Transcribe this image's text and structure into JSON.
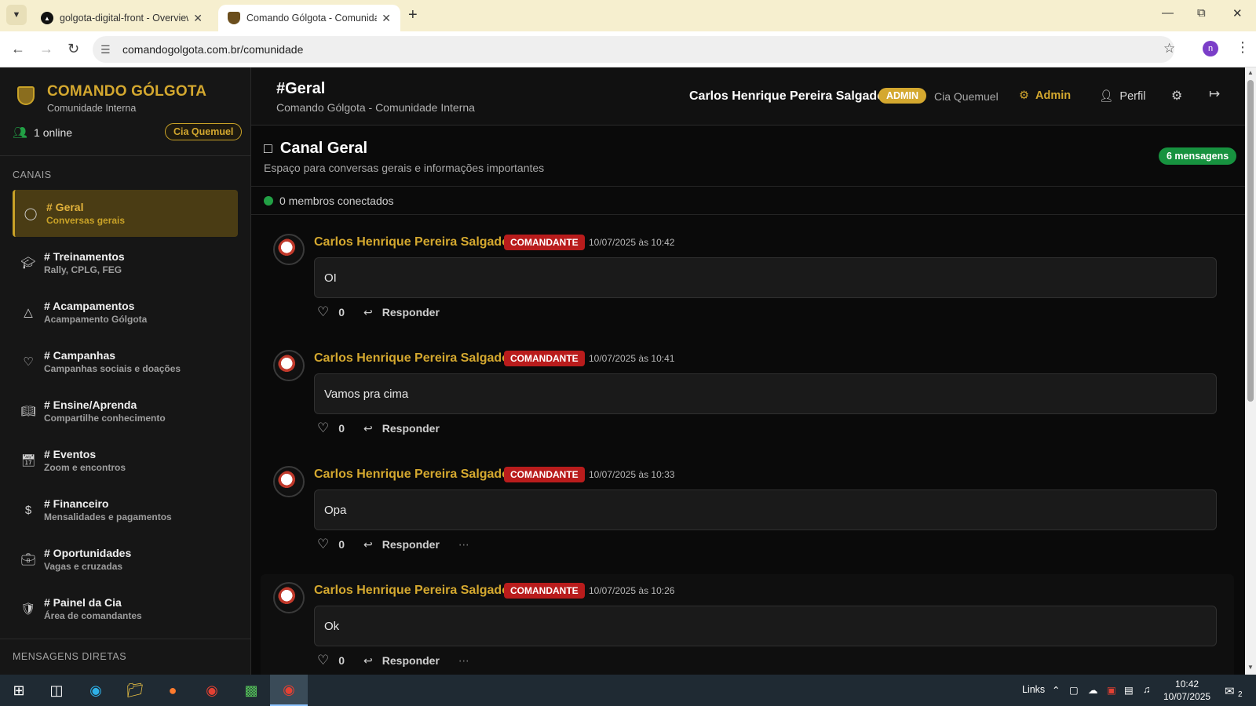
{
  "browser": {
    "tabs": [
      {
        "title": "golgota-digital-front - Overview",
        "active": false
      },
      {
        "title": "Comando Gólgota - Comunidade",
        "active": true
      }
    ],
    "url": "comandogolgota.com.br/comunidade",
    "profile_initial": "n"
  },
  "sidebar": {
    "brand_name": "COMANDO GÓLGOTA",
    "brand_sub": "Comunidade Interna",
    "online_text": "1 online",
    "cia_pill": "Cia Quemuel",
    "channels_label": "CANAIS",
    "channels": [
      {
        "name": "# Geral",
        "desc": "Conversas gerais",
        "icon": "chat-bubble-icon",
        "active": true
      },
      {
        "name": "# Treinamentos",
        "desc": "Rally, CPLG, FEG",
        "icon": "graduation-cap-icon",
        "active": false
      },
      {
        "name": "# Acampamentos",
        "desc": "Acampamento Gólgota",
        "icon": "tent-icon",
        "active": false
      },
      {
        "name": "# Campanhas",
        "desc": "Campanhas sociais e doações",
        "icon": "heart-icon",
        "active": false
      },
      {
        "name": "# Ensine/Aprenda",
        "desc": "Compartilhe conhecimento",
        "icon": "book-icon",
        "active": false
      },
      {
        "name": "# Eventos",
        "desc": "Zoom e encontros",
        "icon": "calendar-icon",
        "active": false
      },
      {
        "name": "# Financeiro",
        "desc": "Mensalidades e pagamentos",
        "icon": "dollar-icon",
        "active": false
      },
      {
        "name": "# Oportunidades",
        "desc": "Vagas e cruzadas",
        "icon": "briefcase-icon",
        "active": false
      },
      {
        "name": "# Painel da Cia",
        "desc": "Área de comandantes",
        "icon": "shield-icon",
        "active": false
      }
    ],
    "dm_label": "MENSAGENS DIRETAS"
  },
  "topbar": {
    "title": "#Geral",
    "subtitle": "Comando Gólgota - Comunidade Interna",
    "user_name": "Carlos Henrique Pereira Salgado",
    "role_badge": "ADMIN",
    "cia": "Cia Quemuel",
    "admin_link": "Admin",
    "profile_link": "Perfil"
  },
  "channel_header": {
    "title": "Canal Geral",
    "subtitle": "Espaço para conversas gerais e informações importantes",
    "message_count": "6 mensagens",
    "members_text": "0 membros conectados"
  },
  "messages": [
    {
      "author": "Carlos Henrique Pereira Salgado",
      "role": "COMANDANTE",
      "timestamp": "10/07/2025 às 10:42",
      "text": "OI",
      "likes": "0",
      "reply_label": "Responder"
    },
    {
      "author": "Carlos Henrique Pereira Salgado",
      "role": "COMANDANTE",
      "timestamp": "10/07/2025 às 10:41",
      "text": "Vamos pra cima",
      "likes": "0",
      "reply_label": "Responder"
    },
    {
      "author": "Carlos Henrique Pereira Salgado",
      "role": "COMANDANTE",
      "timestamp": "10/07/2025 às 10:33",
      "text": "Opa",
      "likes": "0",
      "reply_label": "Responder"
    },
    {
      "author": "Carlos Henrique Pereira Salgado",
      "role": "COMANDANTE",
      "timestamp": "10/07/2025 às 10:26",
      "text": "Ok",
      "likes": "0",
      "reply_label": "Responder"
    }
  ],
  "taskbar": {
    "links_label": "Links",
    "time": "10:42",
    "date": "10/07/2025",
    "notification_count": "2"
  },
  "colors": {
    "accent_gold": "#d4a82f",
    "role_red": "#b91c1c",
    "count_green": "#17923f",
    "online_green": "#22a045"
  }
}
